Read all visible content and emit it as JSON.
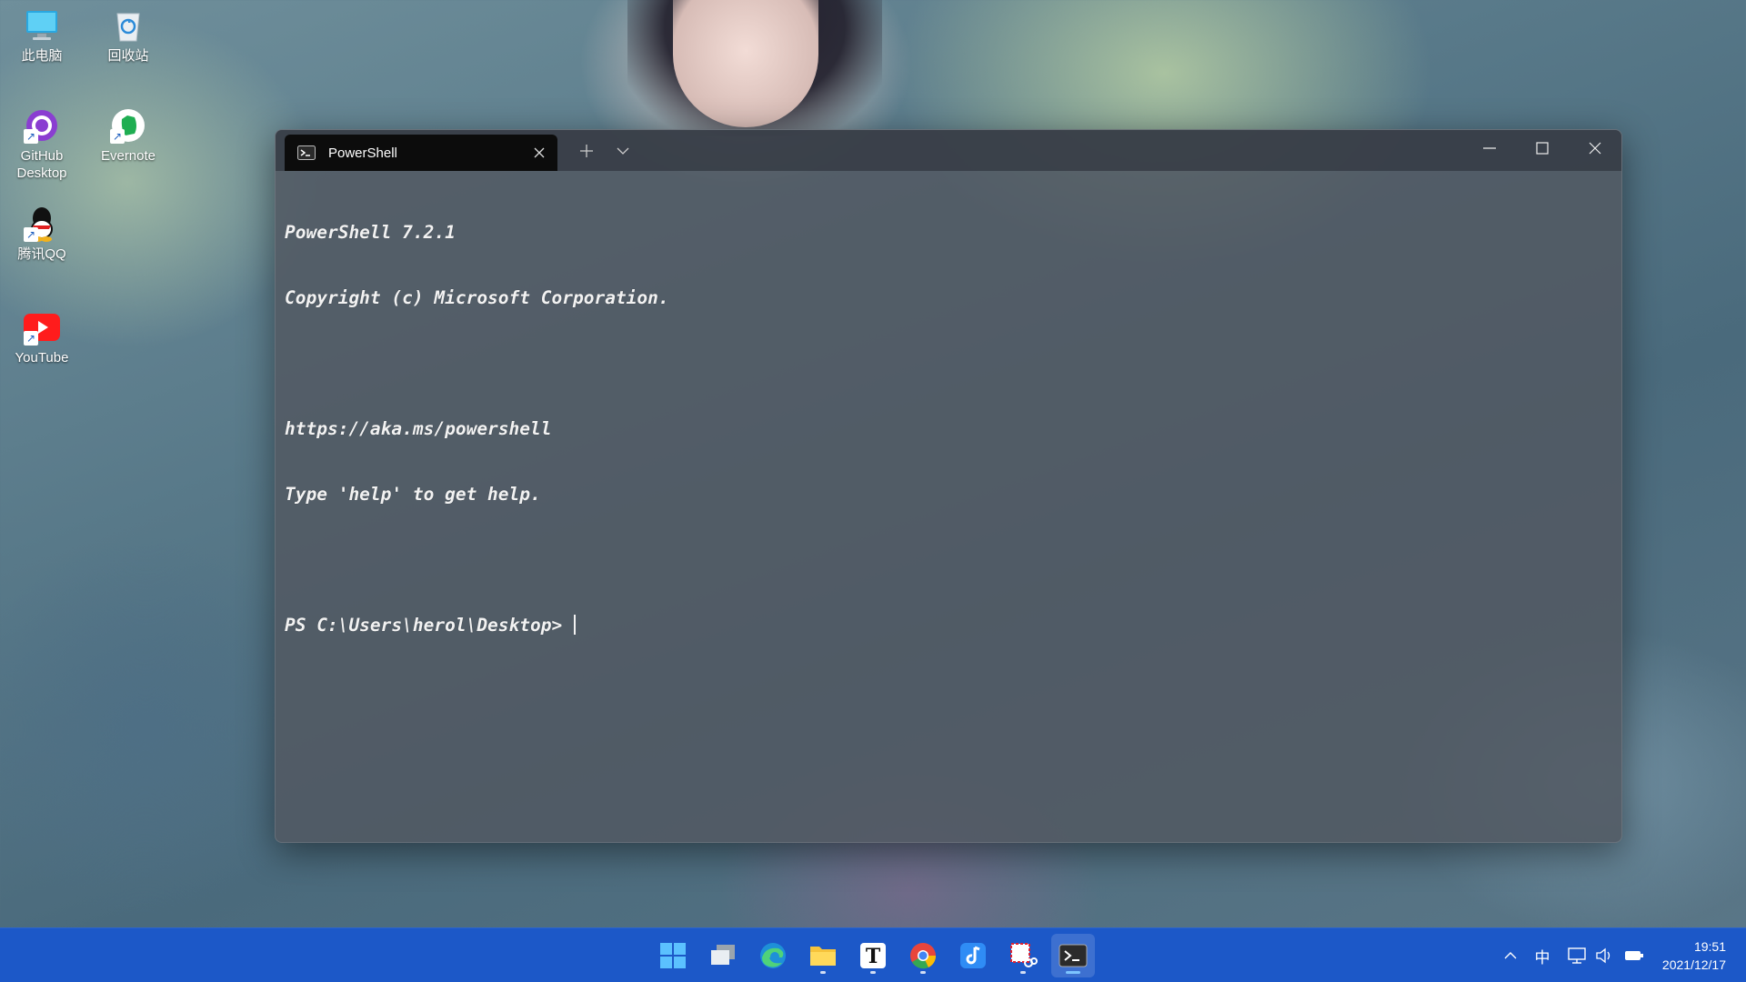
{
  "desktop": {
    "icons": [
      {
        "label": "此电脑",
        "icon": "computer-icon"
      },
      {
        "label": "回收站",
        "icon": "recycle-bin-icon"
      },
      {
        "label_line1": "GitHub",
        "label_line2": "Desktop",
        "icon": "github-desktop-icon"
      },
      {
        "label": "Evernote",
        "icon": "evernote-icon"
      },
      {
        "label": "腾讯QQ",
        "icon": "qq-icon"
      },
      {
        "label": "YouTube",
        "icon": "youtube-icon"
      }
    ]
  },
  "terminal": {
    "tab_title": "PowerShell",
    "lines": [
      "PowerShell 7.2.1",
      "Copyright (c) Microsoft Corporation.",
      "",
      "https://aka.ms/powershell",
      "Type 'help' to get help.",
      "",
      "PS C:\\Users\\herol\\Desktop> "
    ]
  },
  "taskbar": {
    "apps": [
      {
        "name": "start",
        "icon": "windows-start-icon"
      },
      {
        "name": "task-view",
        "icon": "task-view-icon"
      },
      {
        "name": "edge",
        "icon": "edge-icon"
      },
      {
        "name": "file-explorer",
        "icon": "folder-icon"
      },
      {
        "name": "typora",
        "icon": "typora-icon"
      },
      {
        "name": "chrome",
        "icon": "chrome-icon"
      },
      {
        "name": "music",
        "icon": "music-app-icon"
      },
      {
        "name": "snipping-tool",
        "icon": "snipping-tool-icon"
      },
      {
        "name": "terminal",
        "icon": "terminal-icon"
      }
    ],
    "tray": {
      "ime": "中",
      "time": "19:51",
      "date": "2021/12/17"
    }
  }
}
